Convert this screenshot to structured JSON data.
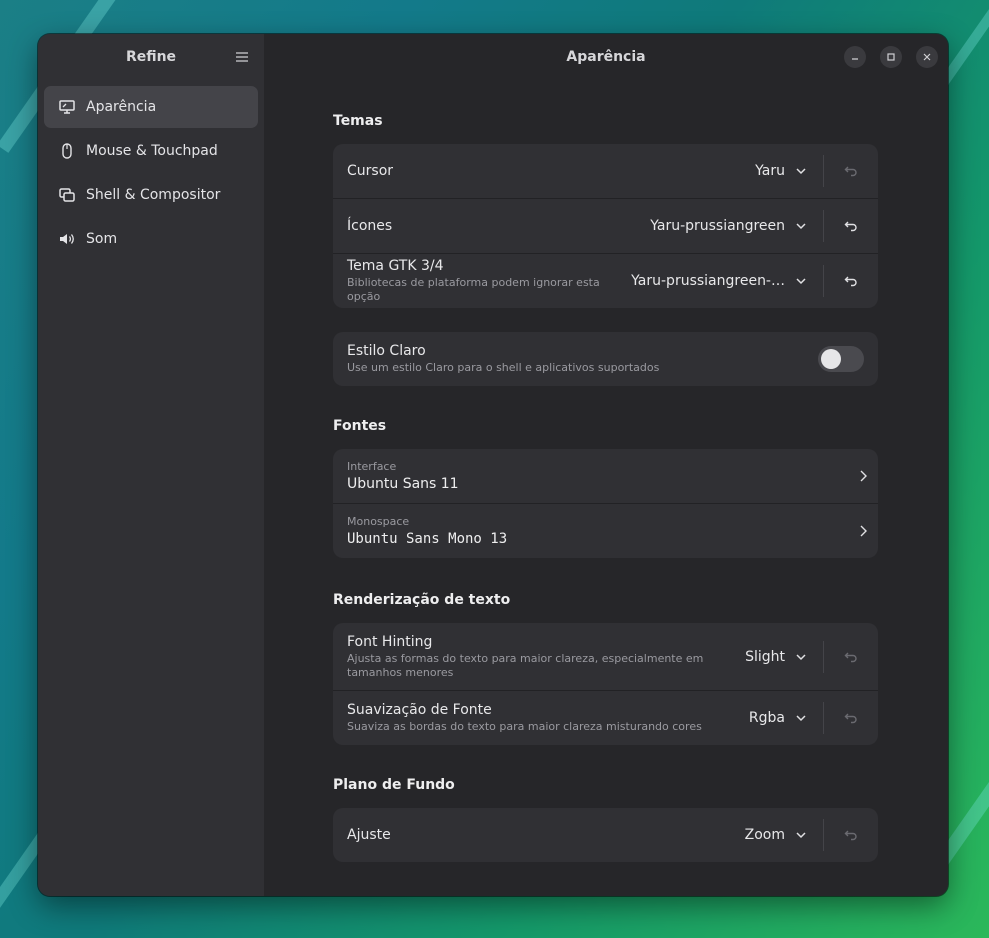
{
  "sidebar": {
    "title": "Refine",
    "items": [
      {
        "label": "Aparência",
        "icon": "display-icon"
      },
      {
        "label": "Mouse & Touchpad",
        "icon": "mouse-icon"
      },
      {
        "label": "Shell & Compositor",
        "icon": "windows-icon"
      },
      {
        "label": "Som",
        "icon": "speaker-icon"
      }
    ]
  },
  "header": {
    "title": "Aparência"
  },
  "themes": {
    "section": "Temas",
    "cursor": {
      "title": "Cursor",
      "value": "Yaru"
    },
    "icons": {
      "title": "Ícones",
      "value": "Yaru-prussiangreen"
    },
    "gtk": {
      "title": "Tema GTK 3/4",
      "subtitle": "Bibliotecas de plataforma podem ignorar esta opção",
      "value": "Yaru-prussiangreen-…"
    }
  },
  "light_style": {
    "title": "Estilo Claro",
    "subtitle": "Use um estilo Claro para o shell e aplicativos suportados",
    "enabled": false
  },
  "fonts": {
    "section": "Fontes",
    "interface": {
      "label": "Interface",
      "value": "Ubuntu Sans 11"
    },
    "monospace": {
      "label": "Monospace",
      "value": "Ubuntu Sans Mono 13"
    }
  },
  "rendering": {
    "section": "Renderização de texto",
    "hinting": {
      "title": "Font Hinting",
      "subtitle": "Ajusta as formas do texto para maior clareza, especialmente em tamanhos menores",
      "value": "Slight"
    },
    "smoothing": {
      "title": "Suavização de Fonte",
      "subtitle": "Suaviza as bordas do texto para maior clareza misturando cores",
      "value": "Rgba"
    }
  },
  "background": {
    "section": "Plano de Fundo",
    "fit": {
      "title": "Ajuste",
      "value": "Zoom"
    }
  },
  "colors": {
    "window_bg": "#262629",
    "sidebar_bg": "#303034",
    "card_bg": "#303034",
    "active_item": "#444449"
  }
}
